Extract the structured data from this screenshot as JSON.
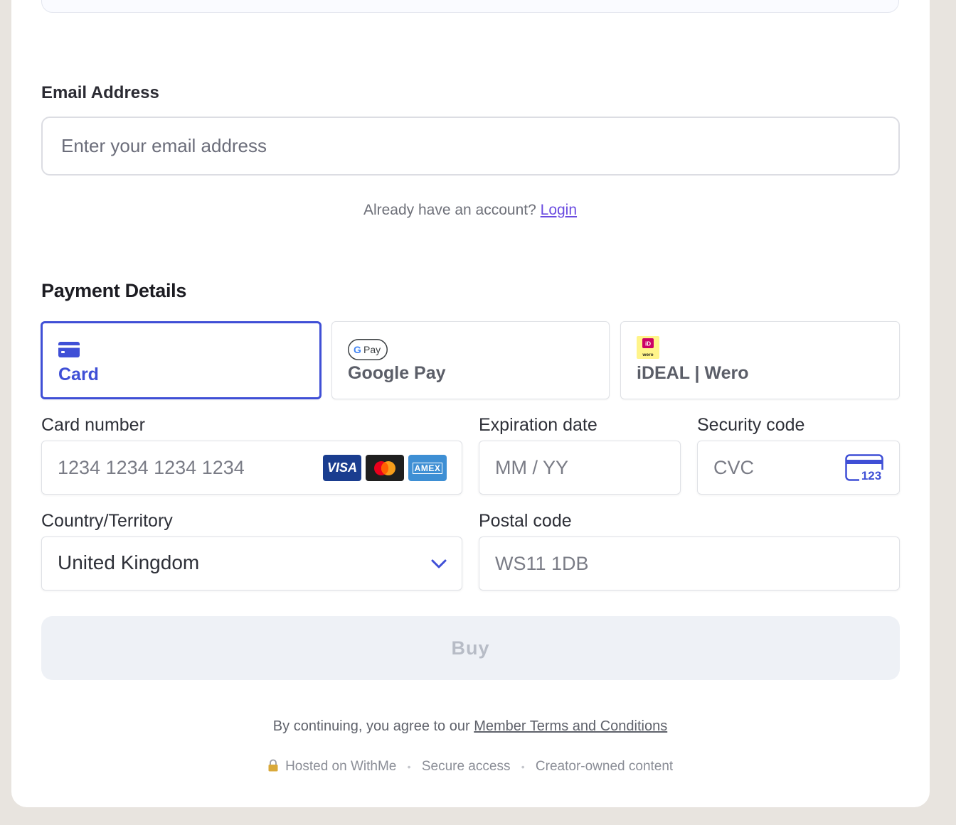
{
  "email": {
    "label": "Email Address",
    "placeholder": "Enter your email address",
    "account_prompt": "Already have an account?",
    "login_link": "Login"
  },
  "payment": {
    "title": "Payment Details",
    "methods": [
      {
        "label": "Card",
        "icon": "credit-card-icon",
        "selected": true
      },
      {
        "label": "Google Pay",
        "icon": "google-pay-icon",
        "icon_text": "Pay",
        "selected": false
      },
      {
        "label": "iDEAL | Wero",
        "icon": "ideal-wero-icon",
        "icon_text": "wero",
        "selected": false
      }
    ],
    "card_number": {
      "label": "Card number",
      "placeholder": "1234 1234 1234 1234"
    },
    "card_brands": [
      "VISA",
      "mastercard",
      "AMEX"
    ],
    "expiration": {
      "label": "Expiration date",
      "placeholder": "MM / YY"
    },
    "security": {
      "label": "Security code",
      "placeholder": "CVC",
      "icon_text": "123"
    },
    "country": {
      "label": "Country/Territory",
      "value": "United Kingdom"
    },
    "postal": {
      "label": "Postal code",
      "placeholder": "WS11 1DB"
    }
  },
  "buy_button": "Buy",
  "terms": {
    "prefix": "By continuing, you agree to our",
    "link": "Member Terms and Conditions"
  },
  "footer": {
    "hosted": "Hosted on WithMe",
    "secure": "Secure access",
    "creator": "Creator-owned content"
  },
  "colors": {
    "accent": "#3f4fd6",
    "link": "#6a4be0",
    "background": "#e8e4df",
    "button_disabled": "#eef1f6"
  }
}
